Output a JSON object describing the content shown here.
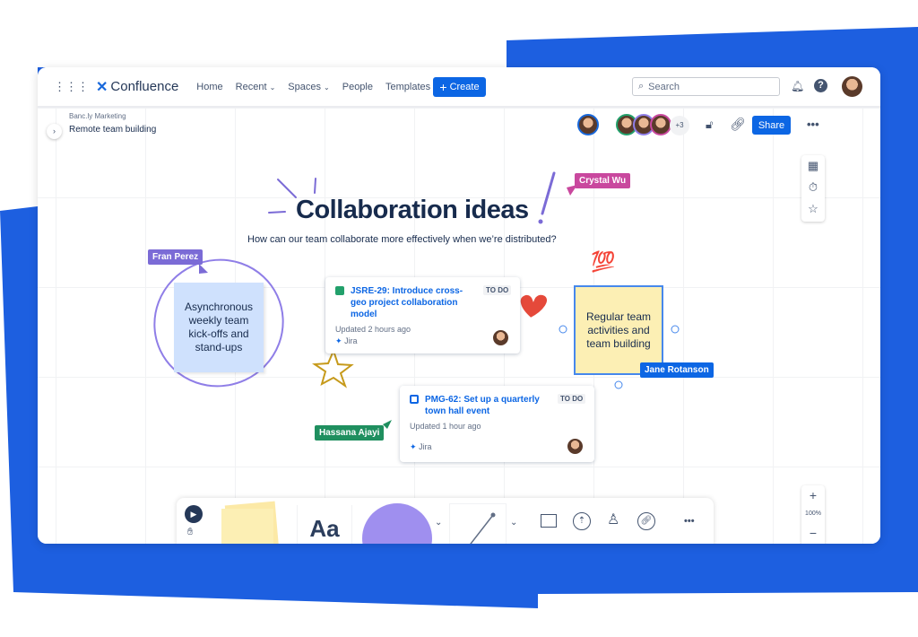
{
  "colors": {
    "brand_blue": "#1d5fe0",
    "primary": "#0c66e4"
  },
  "header": {
    "logo": "Confluence",
    "nav": [
      "Home",
      "Recent",
      "Spaces",
      "People",
      "Templates"
    ],
    "create_label": "Create",
    "search_placeholder": "Search"
  },
  "breadcrumb": {
    "space": "Banc.ly Marketing",
    "page": "Remote team building"
  },
  "toolbar": {
    "extra_collaborators": "+3",
    "share_label": "Share"
  },
  "board": {
    "title": "Collaboration ideas",
    "subtitle": "How can our team collaborate more effectively when we’re distributed?",
    "stickies": [
      {
        "text": "Asynchronous weekly team kick-offs and stand-ups"
      },
      {
        "text": "Regular team activities and team building"
      }
    ],
    "cards": [
      {
        "title": "JSRE-29: Introduce cross-geo project collaboration model",
        "status": "TO DO",
        "updated": "Updated 2 hours ago",
        "source": "Jira"
      },
      {
        "title": "PMG-62: Set up a quarterly town hall event",
        "status": "TO DO",
        "updated": "Updated 1 hour ago",
        "source": "Jira"
      }
    ],
    "cursors": [
      {
        "name": "Crystal Wu",
        "color": "#c9489e"
      },
      {
        "name": "Fran Perez",
        "color": "#7b6bd6"
      },
      {
        "name": "Jane Rotanson",
        "color": "#0c66e4"
      },
      {
        "name": "Hassana Ajayi",
        "color": "#1f8f5f"
      }
    ],
    "emoji": "💯"
  },
  "bottom_toolbar": {
    "text_tool": "Aa"
  },
  "zoom": {
    "level": "100%",
    "plus": "+",
    "minus": "−"
  }
}
